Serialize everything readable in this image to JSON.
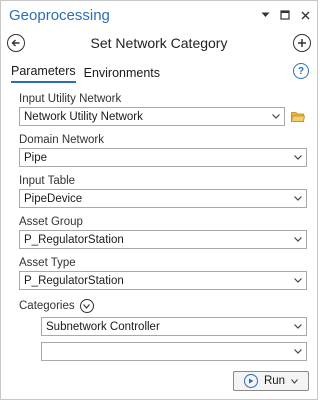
{
  "window": {
    "title": "Geoprocessing",
    "controls": {
      "dropdown_icon": "chevron-down-icon",
      "restore_icon": "restore-icon",
      "close_icon": "close-icon"
    }
  },
  "tool": {
    "title": "Set Network Category",
    "back_icon": "back-arrow-icon",
    "add_icon": "add-icon"
  },
  "tabs": [
    {
      "label": "Parameters",
      "active": true
    },
    {
      "label": "Environments",
      "active": false
    }
  ],
  "help_icon": "help-icon",
  "params": {
    "input_utility_network": {
      "label": "Input Utility Network",
      "value": "Network Utility Network"
    },
    "domain_network": {
      "label": "Domain Network",
      "value": "Pipe"
    },
    "input_table": {
      "label": "Input Table",
      "value": "PipeDevice"
    },
    "asset_group": {
      "label": "Asset Group",
      "value": "P_RegulatorStation"
    },
    "asset_type": {
      "label": "Asset Type",
      "value": "P_RegulatorStation"
    },
    "categories": {
      "label": "Categories",
      "items": [
        "Subnetwork Controller",
        ""
      ]
    }
  },
  "run_button": {
    "label": "Run"
  },
  "colors": {
    "accent": "#2a6fb3",
    "folder": "#e6b53a"
  }
}
